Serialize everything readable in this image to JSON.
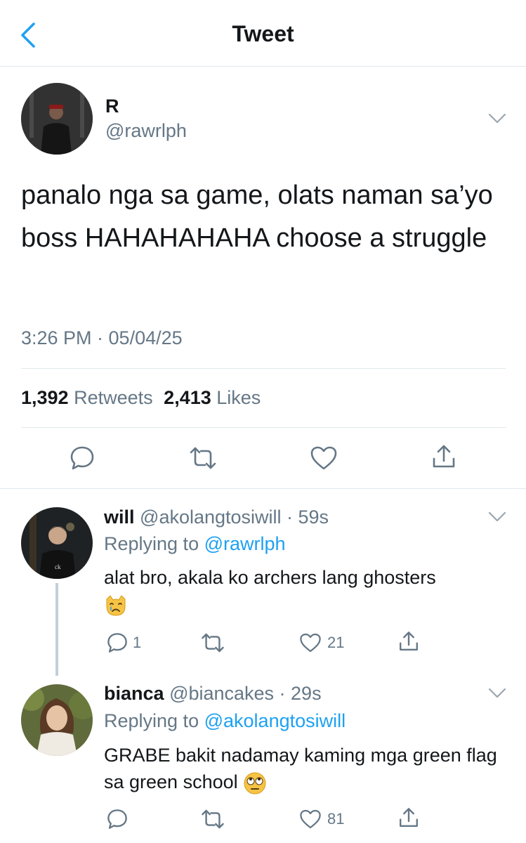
{
  "header": {
    "title": "Tweet"
  },
  "tweet": {
    "name": "R",
    "handle": "@rawrlph",
    "text": "panalo nga sa game, olats naman sa’yo boss HAHAHAHAHA choose a struggle",
    "timestamp": "3:26 PM · 05/04/25",
    "retweets_count": "1,392",
    "retweets_label": "Retweets",
    "likes_count": "2,413",
    "likes_label": "Likes"
  },
  "replies": [
    {
      "name": "will",
      "handle_time": "@akolangtosiwill · 59s",
      "replying_label": "Replying to",
      "replying_to": "@rawrlph",
      "text": "alat bro, akala ko archers lang ghosters",
      "emoji": "crying-cat-face",
      "reply_count": "1",
      "like_count": "21"
    },
    {
      "name": "bianca",
      "handle_time": "@biancakes · 29s",
      "replying_label": "Replying to",
      "replying_to": "@akolangtosiwill",
      "text": "GRABE bakit nadamay kaming mga green flag sa green school",
      "emoji": "face-with-rolling-eyes",
      "reply_count": "",
      "like_count": "81"
    }
  ],
  "colors": {
    "accent": "#1da1f2",
    "secondary_text": "#657786",
    "divider": "#e1e8ed"
  }
}
